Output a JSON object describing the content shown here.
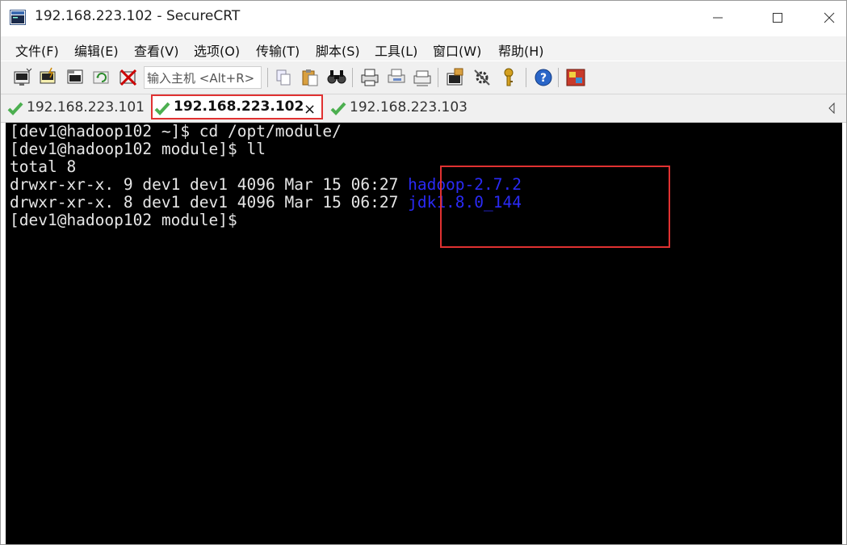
{
  "window": {
    "title": "192.168.223.102 - SecureCRT"
  },
  "menu": {
    "items": [
      "文件(F)",
      "编辑(E)",
      "查看(V)",
      "选项(O)",
      "传输(T)",
      "脚本(S)",
      "工具(L)",
      "窗口(W)",
      "帮助(H)"
    ]
  },
  "toolbar": {
    "host_input_value": "输入主机 <Alt+R>",
    "icons": [
      "connect-icon",
      "quick-connect-icon",
      "connect-in-tab-icon",
      "reconnect-icon",
      "disconnect-icon",
      "copy-icon",
      "paste-icon",
      "find-icon",
      "print-icon",
      "print-selection-icon",
      "printer-setup-icon",
      "session-options-icon",
      "global-options-icon",
      "keymap-icon",
      "help-icon",
      "sftp-icon"
    ]
  },
  "tabs": [
    {
      "label": "192.168.223.101",
      "active": false,
      "status": "connected"
    },
    {
      "label": "192.168.223.102",
      "active": true,
      "status": "connected",
      "close": "×"
    },
    {
      "label": "192.168.223.103",
      "active": false,
      "status": "connected"
    }
  ],
  "terminal": {
    "lines": [
      "[dev1@hadoop102 ~]$ cd /opt/module/",
      "[dev1@hadoop102 module]$ ll",
      "total 8",
      "drwxr-xr-x. 9 dev1 dev1 4096 Mar 15 06:27 ",
      "drwxr-xr-x. 8 dev1 dev1 4096 Mar 15 06:27 ",
      "[dev1@hadoop102 module]$ "
    ],
    "dir_names": [
      "hadoop-2.7.2",
      "jdk1.8.0_144"
    ],
    "colors": {
      "background": "#000000",
      "text": "#e6e6e6",
      "directory": "#2a2af5"
    }
  },
  "colors": {
    "highlight": "#e03131",
    "check": "#4caf50"
  }
}
